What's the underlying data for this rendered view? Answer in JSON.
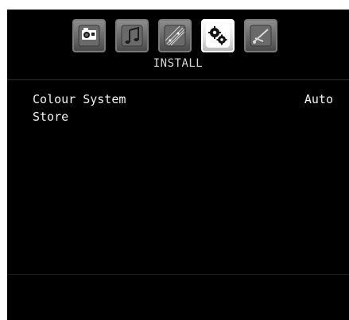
{
  "menu_tabs": [
    {
      "icon": "camera-icon"
    },
    {
      "icon": "music-note-icon"
    },
    {
      "icon": "sparkle-picture-icon"
    },
    {
      "icon": "gears-icon",
      "active": true
    },
    {
      "icon": "satellite-dish-icon"
    }
  ],
  "title": "INSTALL",
  "items": [
    {
      "label": "Colour System",
      "value": "Auto"
    },
    {
      "label": "Store",
      "value": ""
    }
  ],
  "colors": {
    "background": "#000000",
    "text": "#f2f2f2",
    "tab_active": "#ffffff",
    "tab_inactive": "#6c6c6c"
  }
}
